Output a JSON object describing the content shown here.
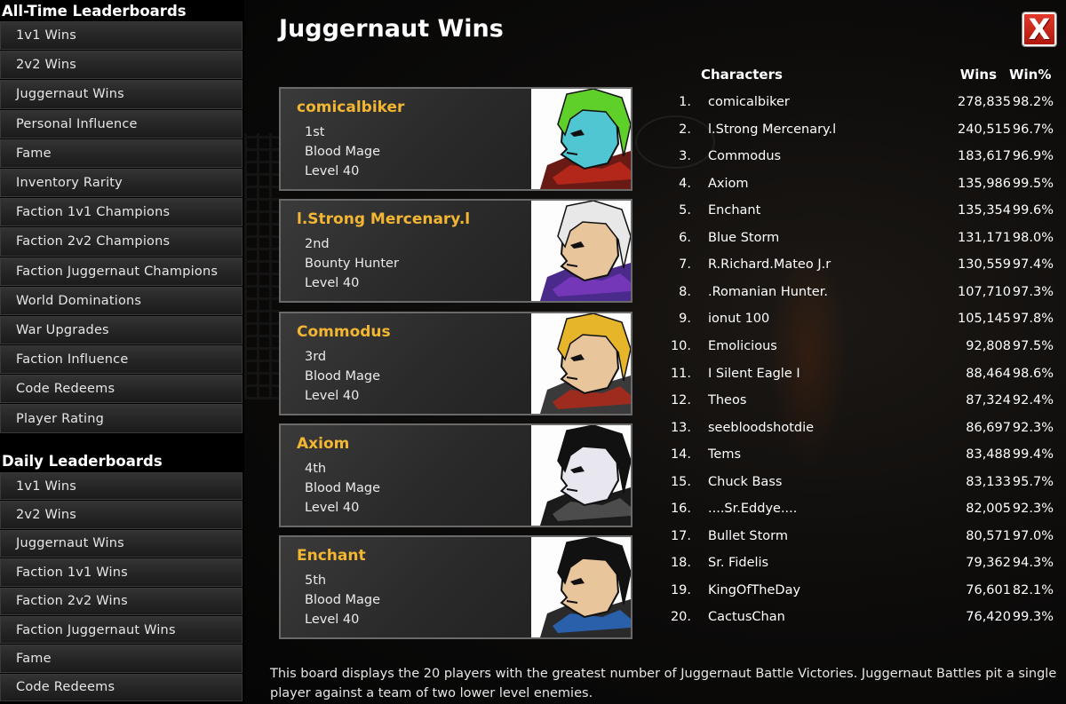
{
  "sidebar": {
    "alltime_title": "All-Time Leaderboards",
    "alltime_items": [
      "1v1 Wins",
      "2v2 Wins",
      "Juggernaut Wins",
      "Personal Influence",
      "Fame",
      "Inventory Rarity",
      "Faction 1v1 Champions",
      "Faction 2v2 Champions",
      "Faction Juggernaut Champions",
      "World Dominations",
      "War Upgrades",
      "Faction Influence",
      "Code Redeems",
      "Player Rating"
    ],
    "daily_title": "Daily Leaderboards",
    "daily_items": [
      "1v1 Wins",
      "2v2 Wins",
      "Juggernaut Wins",
      "Faction 1v1 Wins",
      "Faction 2v2 Wins",
      "Faction Juggernaut Wins",
      "Fame",
      "Code Redeems"
    ]
  },
  "header": {
    "title": "Juggernaut Wins",
    "close_label": "X"
  },
  "top_cards": [
    {
      "name": "comicalbiker",
      "rank": "1st",
      "class": "Blood Mage",
      "level": "Level 40",
      "hair": "#5fd02a",
      "skin": "#4fc6d2",
      "armor": "#6a1a14",
      "accent": "#c02a1c"
    },
    {
      "name": "l.Strong Mercenary.l",
      "rank": "2nd",
      "class": "Bounty Hunter",
      "level": "Level 40",
      "hair": "#e8e8e8",
      "skin": "#e9c59b",
      "armor": "#4a2a8a",
      "accent": "#7a3ac0"
    },
    {
      "name": "Commodus",
      "rank": "3rd",
      "class": "Blood Mage",
      "level": "Level 40",
      "hair": "#e7b52a",
      "skin": "#e9c59b",
      "armor": "#3a3a3a",
      "accent": "#b02a1a"
    },
    {
      "name": "Axiom",
      "rank": "4th",
      "class": "Blood Mage",
      "level": "Level 40",
      "hair": "#111111",
      "skin": "#e8e6ee",
      "armor": "#1b1b1b",
      "accent": "#555555"
    },
    {
      "name": "Enchant",
      "rank": "5th",
      "class": "Blood Mage",
      "level": "Level 40",
      "hair": "#111111",
      "skin": "#e9c59b",
      "armor": "#2a2a2a",
      "accent": "#2a6ac0"
    }
  ],
  "table": {
    "headers": {
      "characters": "Characters",
      "wins": "Wins",
      "winpct": "Win%"
    },
    "rows": [
      [
        "1.",
        "comicalbiker",
        "278,835",
        "98.2%"
      ],
      [
        "2.",
        "l.Strong Mercenary.l",
        "240,515",
        "96.7%"
      ],
      [
        "3.",
        "Commodus",
        "183,617",
        "96.9%"
      ],
      [
        "4.",
        "Axiom",
        "135,986",
        "99.5%"
      ],
      [
        "5.",
        "Enchant",
        "135,354",
        "99.6%"
      ],
      [
        "6.",
        "Blue Storm",
        "131,171",
        "98.0%"
      ],
      [
        "7.",
        "R.Richard.Mateo J.r",
        "130,559",
        "97.4%"
      ],
      [
        "8.",
        ".Romanian Hunter.",
        "107,710",
        "97.3%"
      ],
      [
        "9.",
        "ionut 100",
        "105,145",
        "97.8%"
      ],
      [
        "10.",
        "Emolicious",
        "92,808",
        "97.5%"
      ],
      [
        "11.",
        "I Silent Eagle I",
        "88,464",
        "98.6%"
      ],
      [
        "12.",
        "Theos",
        "87,324",
        "92.4%"
      ],
      [
        "13.",
        "seebloodshotdie",
        "86,697",
        "92.3%"
      ],
      [
        "14.",
        "Tems",
        "83,488",
        "99.4%"
      ],
      [
        "15.",
        "Chuck Bass",
        "83,133",
        "95.7%"
      ],
      [
        "16.",
        "....Sr.Eddye....",
        "82,005",
        "92.3%"
      ],
      [
        "17.",
        "Bullet Storm",
        "80,571",
        "97.0%"
      ],
      [
        "18.",
        "Sr. Fidelis",
        "79,362",
        "94.3%"
      ],
      [
        "19.",
        "KingOfTheDay",
        "76,601",
        "82.1%"
      ],
      [
        "20.",
        "CactusChan",
        "76,420",
        "99.3%"
      ]
    ]
  },
  "description": "This board displays the 20 players with the greatest number of Juggernaut Battle Victories. Juggernaut Battles pit a single player against a team of two lower level enemies."
}
